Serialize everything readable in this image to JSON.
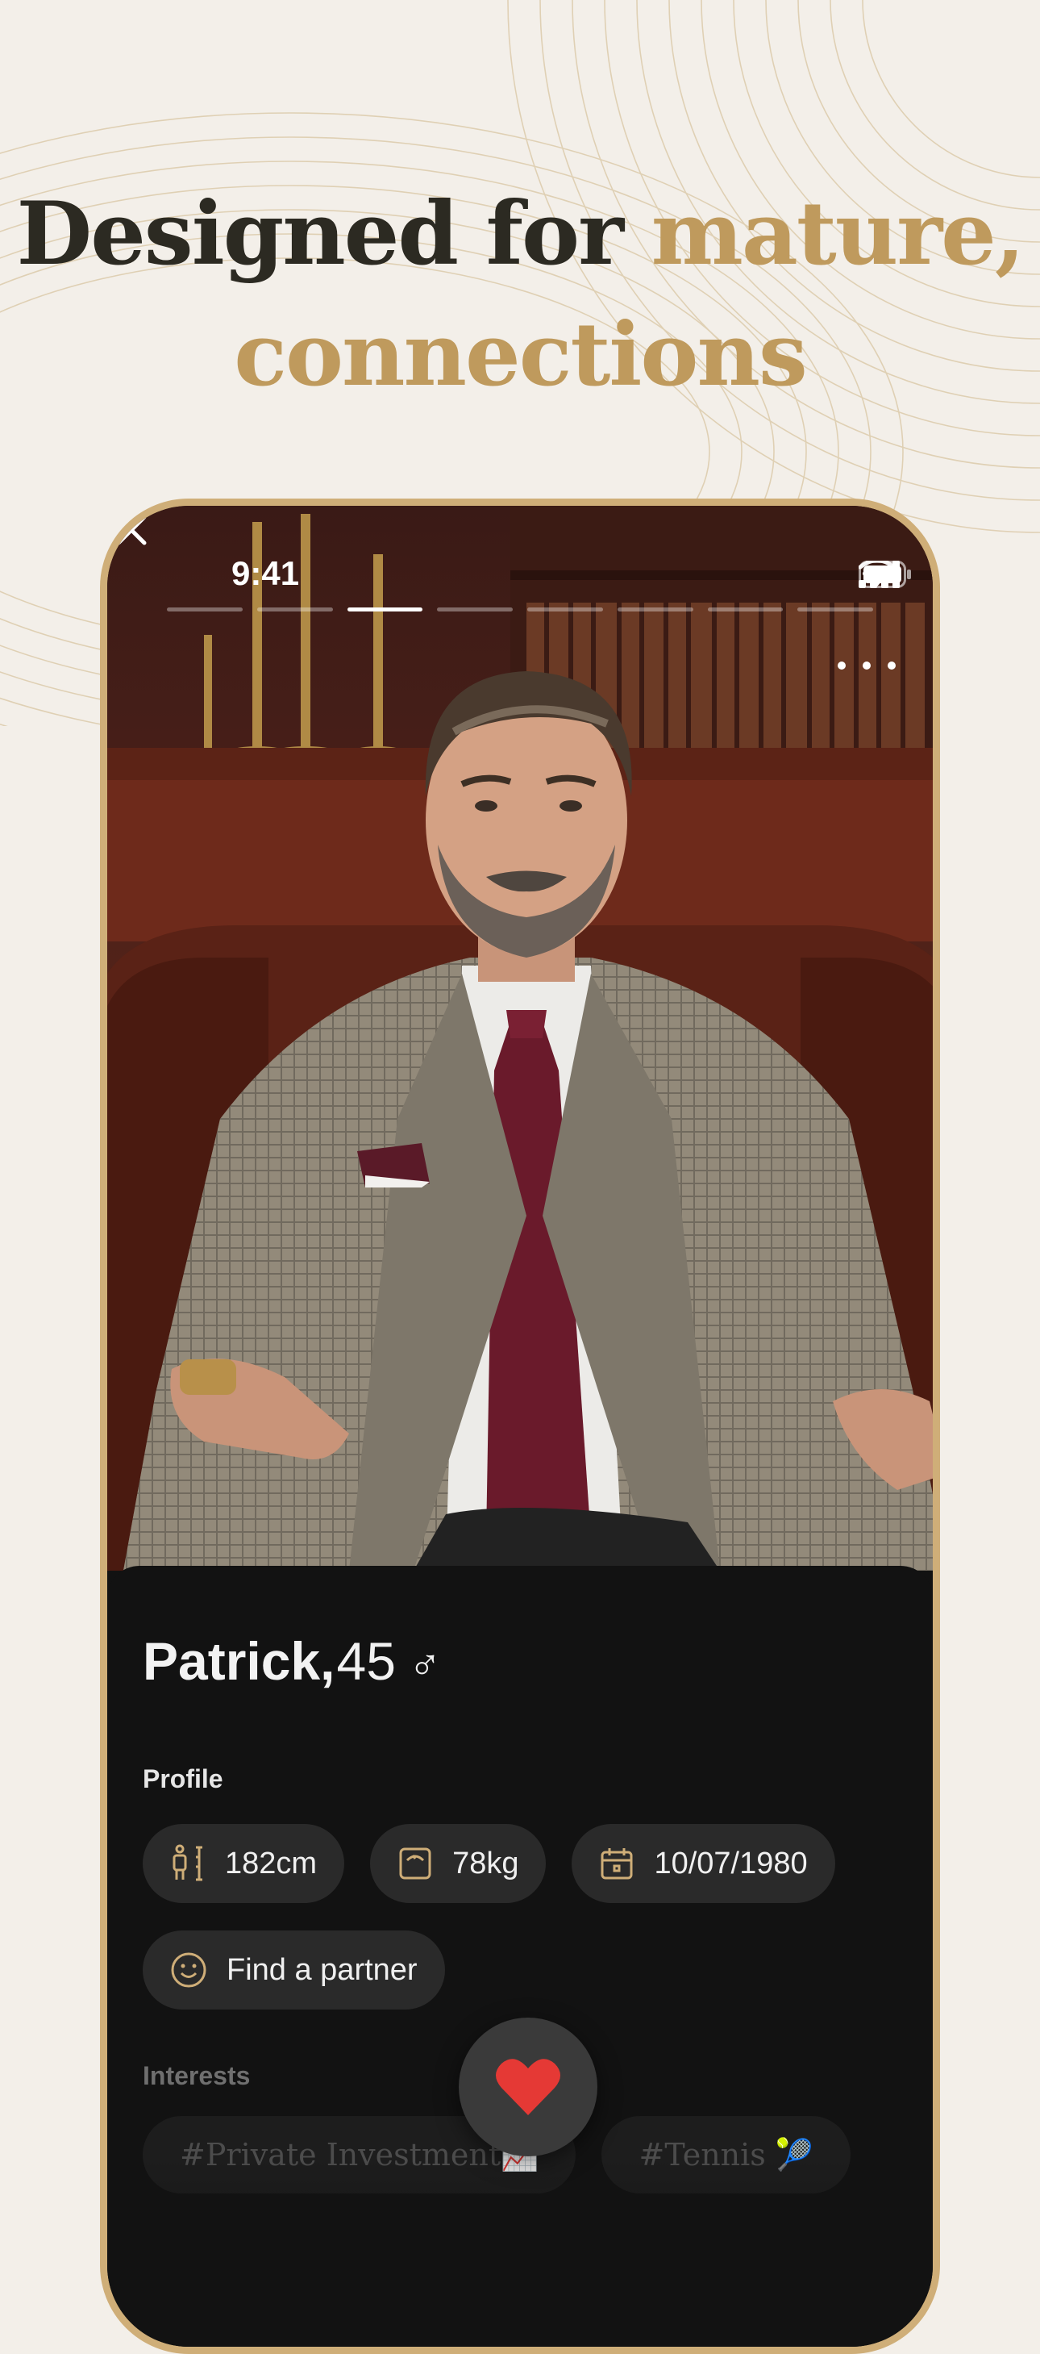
{
  "headline": {
    "line1_dark": "Designed for ",
    "line1_gold": "mature,",
    "line2_gold": "connections"
  },
  "colors": {
    "gold": "#bf9a5d",
    "frame": "#cfae78",
    "dark_text": "#2c2a22",
    "background": "#f3efe9",
    "card": "#121212",
    "chip": "#2a2a2a",
    "heart": "#e53935"
  },
  "status_bar": {
    "time": "9:41",
    "icons": [
      "cellular-signal-icon",
      "wifi-icon",
      "battery-icon"
    ]
  },
  "story_progress": {
    "segments": 8,
    "active_index": 2
  },
  "top_actions": {
    "close": "close-icon",
    "more": "more-horizontal-icon"
  },
  "profile": {
    "name": "Patrick,",
    "age": "45",
    "gender_symbol": "♂",
    "section_label": "Profile",
    "height": "182cm",
    "weight": "78kg",
    "birthdate": "10/07/1980",
    "goal": "Find a partner"
  },
  "interests": {
    "label": "Interests",
    "items": [
      "#Private Investment📈",
      "#Tennis 🎾"
    ]
  },
  "like_button": {
    "icon": "heart-icon"
  }
}
